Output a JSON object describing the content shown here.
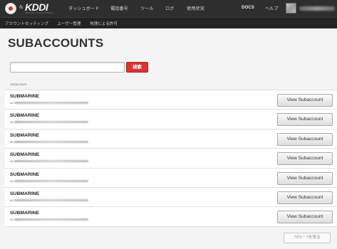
{
  "logo": {
    "text": "KDDI",
    "amp": "&",
    "subtitle": "KDDI Web Communications"
  },
  "nav": {
    "items": [
      "ダッシュボード",
      "電話番号",
      "ツール",
      "ログ",
      "使用状況"
    ],
    "docs": "DOCS",
    "help": "ヘルプ"
  },
  "subnav": {
    "items": [
      "アカウントセッティング",
      "ユーザー管理",
      "地理による許可"
    ]
  },
  "page": {
    "title": "SUBACCOUNTS",
    "search": {
      "value": "",
      "button_label": "検索"
    },
    "column_header": "Subaccount"
  },
  "rows": [
    {
      "name": "SUBMARINE",
      "sid_prefix": "AC",
      "button_label": "View Subaccount"
    },
    {
      "name": "SUBMARINE",
      "sid_prefix": "AC",
      "button_label": "View Subaccount"
    },
    {
      "name": "SUBMARINE",
      "sid_prefix": "AC",
      "button_label": "View Subaccount"
    },
    {
      "name": "SUBMARINE",
      "sid_prefix": "AC",
      "button_label": "View Subaccount"
    },
    {
      "name": "SUBMARINE",
      "sid_prefix": "AC",
      "button_label": "View Subaccount"
    },
    {
      "name": "SUBMARINE",
      "sid_prefix": "AC",
      "button_label": "View Subaccount"
    },
    {
      "name": "SUBMARINE",
      "sid_prefix": "AC",
      "button_label": "View Subaccount"
    }
  ],
  "pager": {
    "label": "7の1－7を見る"
  },
  "colors": {
    "topbar": "#2e2e2e",
    "subnav": "#232323",
    "accent_red": "#d9332f",
    "background": "#f4f4f4"
  }
}
